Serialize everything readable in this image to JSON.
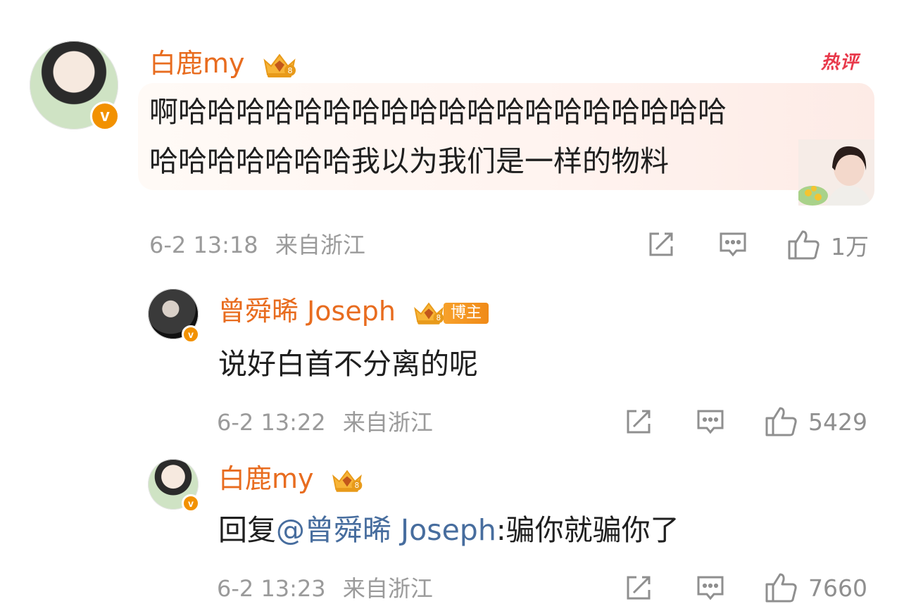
{
  "comments": [
    {
      "username": "白鹿my",
      "text_line1": "啊哈哈哈哈哈哈哈哈哈哈哈哈哈哈哈哈哈哈哈",
      "text_line2": "哈哈哈哈哈哈哈我以为我们是一样的物料",
      "time": "6-2 13:18",
      "location": "来自浙江",
      "likes": "1万",
      "hot_label": "热评"
    },
    {
      "username": "曾舜晞 Joseph",
      "tag": "博主",
      "text": "说好白首不分离的呢",
      "time": "6-2 13:22",
      "location": "来自浙江",
      "likes": "5429"
    },
    {
      "username": "白鹿my",
      "reply_prefix": "回复",
      "mention": "@曾舜晞 Joseph",
      "text": ":骗你就骗你了",
      "time": "6-2 13:23",
      "location": "来自浙江",
      "likes": "7660"
    }
  ],
  "verified_badge": "v",
  "icons": {
    "share": "share-icon",
    "comment": "comment-icon",
    "like": "thumbs-up-icon",
    "crown": "crown-badge-icon"
  },
  "colors": {
    "username": "#e86c1f",
    "mention": "#476d9e",
    "hot": "#e8384a",
    "meta": "#9a9a9a"
  }
}
